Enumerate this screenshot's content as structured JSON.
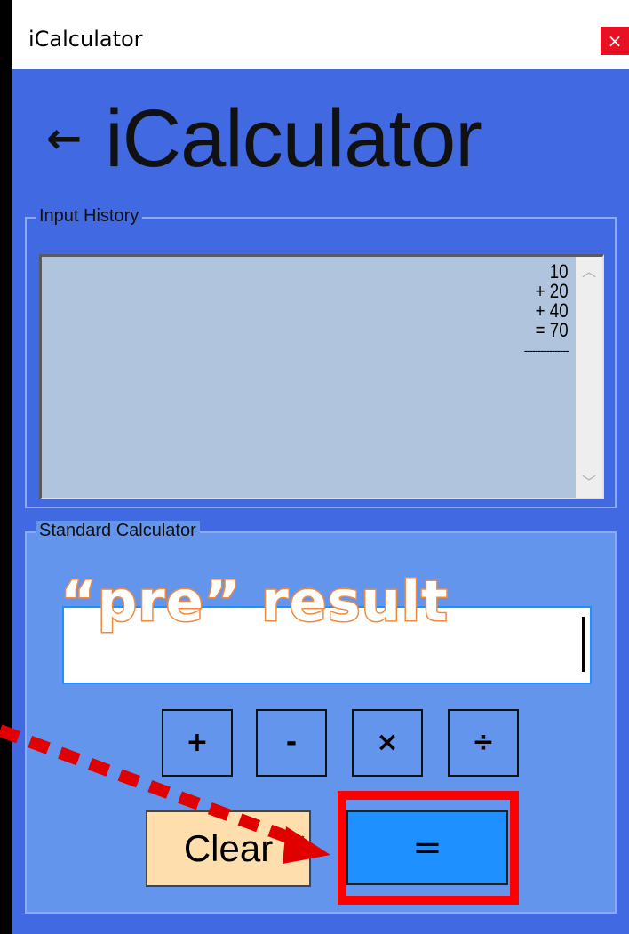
{
  "window": {
    "title": "iCalculator",
    "close_label": "×"
  },
  "header": {
    "back_icon": "←",
    "title": "iCalculator"
  },
  "history": {
    "label": "Input History",
    "lines": [
      "10",
      "+ 20",
      "+ 40",
      "= 70",
      "----------------"
    ],
    "scroll_up": "︿",
    "scroll_down": "﹀"
  },
  "calculator": {
    "label": "Standard Calculator",
    "display_value": "",
    "operators": [
      "+",
      "-",
      "×",
      "÷"
    ],
    "clear_label": "Clear",
    "equals_label": "="
  },
  "annotation": {
    "text": "“pre” result",
    "color": "#f08a3c",
    "arrow_color": "#e00000",
    "highlight_color": "#ff0000"
  },
  "colors": {
    "window_bg": "#4169e1",
    "history_bg": "#b0c4de",
    "calc_bg": "#6495ed",
    "clear_bg": "#ffdead",
    "equals_bg": "#1e90ff"
  }
}
